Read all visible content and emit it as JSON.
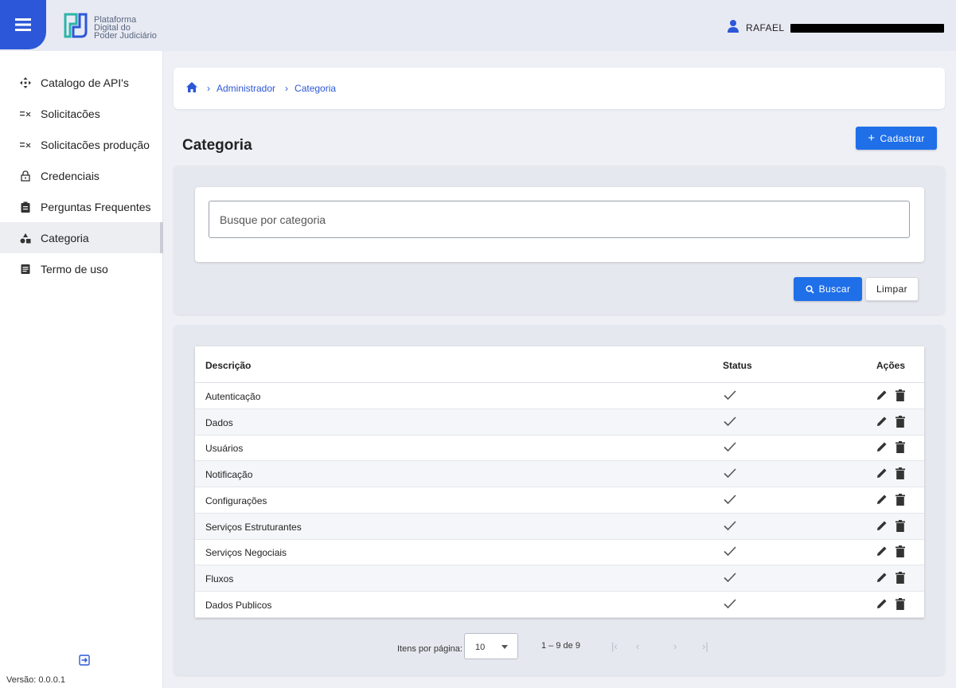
{
  "header": {
    "logo_text": [
      "Plataforma",
      "Digital do",
      "Poder Judiciário"
    ],
    "user_name": "RAFAEL"
  },
  "sidebar": {
    "items": [
      {
        "label": "Catalogo de API's",
        "icon": "move-arrows-icon"
      },
      {
        "label": "Solicitacões",
        "icon": "list-check-icon"
      },
      {
        "label": "Solicitacões produção",
        "icon": "list-check-icon"
      },
      {
        "label": "Credenciais",
        "icon": "lock-icon"
      },
      {
        "label": "Perguntas Frequentes",
        "icon": "clipboard-icon"
      },
      {
        "label": "Categoria",
        "icon": "category-icon",
        "active": true
      },
      {
        "label": "Termo de uso",
        "icon": "document-icon"
      }
    ],
    "version": "Versão: 0.0.0.1"
  },
  "breadcrumb": {
    "items": [
      "Administrador",
      "Categoria"
    ]
  },
  "page": {
    "title": "Categoria",
    "add_button": "Cadastrar"
  },
  "search": {
    "placeholder": "Busque por categoria",
    "search_button": "Buscar",
    "clear_button": "Limpar"
  },
  "table": {
    "headers": {
      "description": "Descrição",
      "status": "Status",
      "actions": "Ações"
    },
    "rows": [
      {
        "description": "Autenticação",
        "status": "active"
      },
      {
        "description": "Dados",
        "status": "active"
      },
      {
        "description": "Usuários",
        "status": "active"
      },
      {
        "description": "Notificação",
        "status": "active"
      },
      {
        "description": "Configurações",
        "status": "active"
      },
      {
        "description": "Serviços Estruturantes",
        "status": "active"
      },
      {
        "description": "Serviços Negociais",
        "status": "active"
      },
      {
        "description": "Fluxos",
        "status": "active"
      },
      {
        "description": "Dados Publicos",
        "status": "active"
      }
    ]
  },
  "paginator": {
    "label": "Itens por página:",
    "page_size": "10",
    "range": "1 – 9 de 9"
  },
  "colors": {
    "primary": "#1f6fe8",
    "header_blue": "#2c57d8",
    "background": "#eef0f6"
  }
}
